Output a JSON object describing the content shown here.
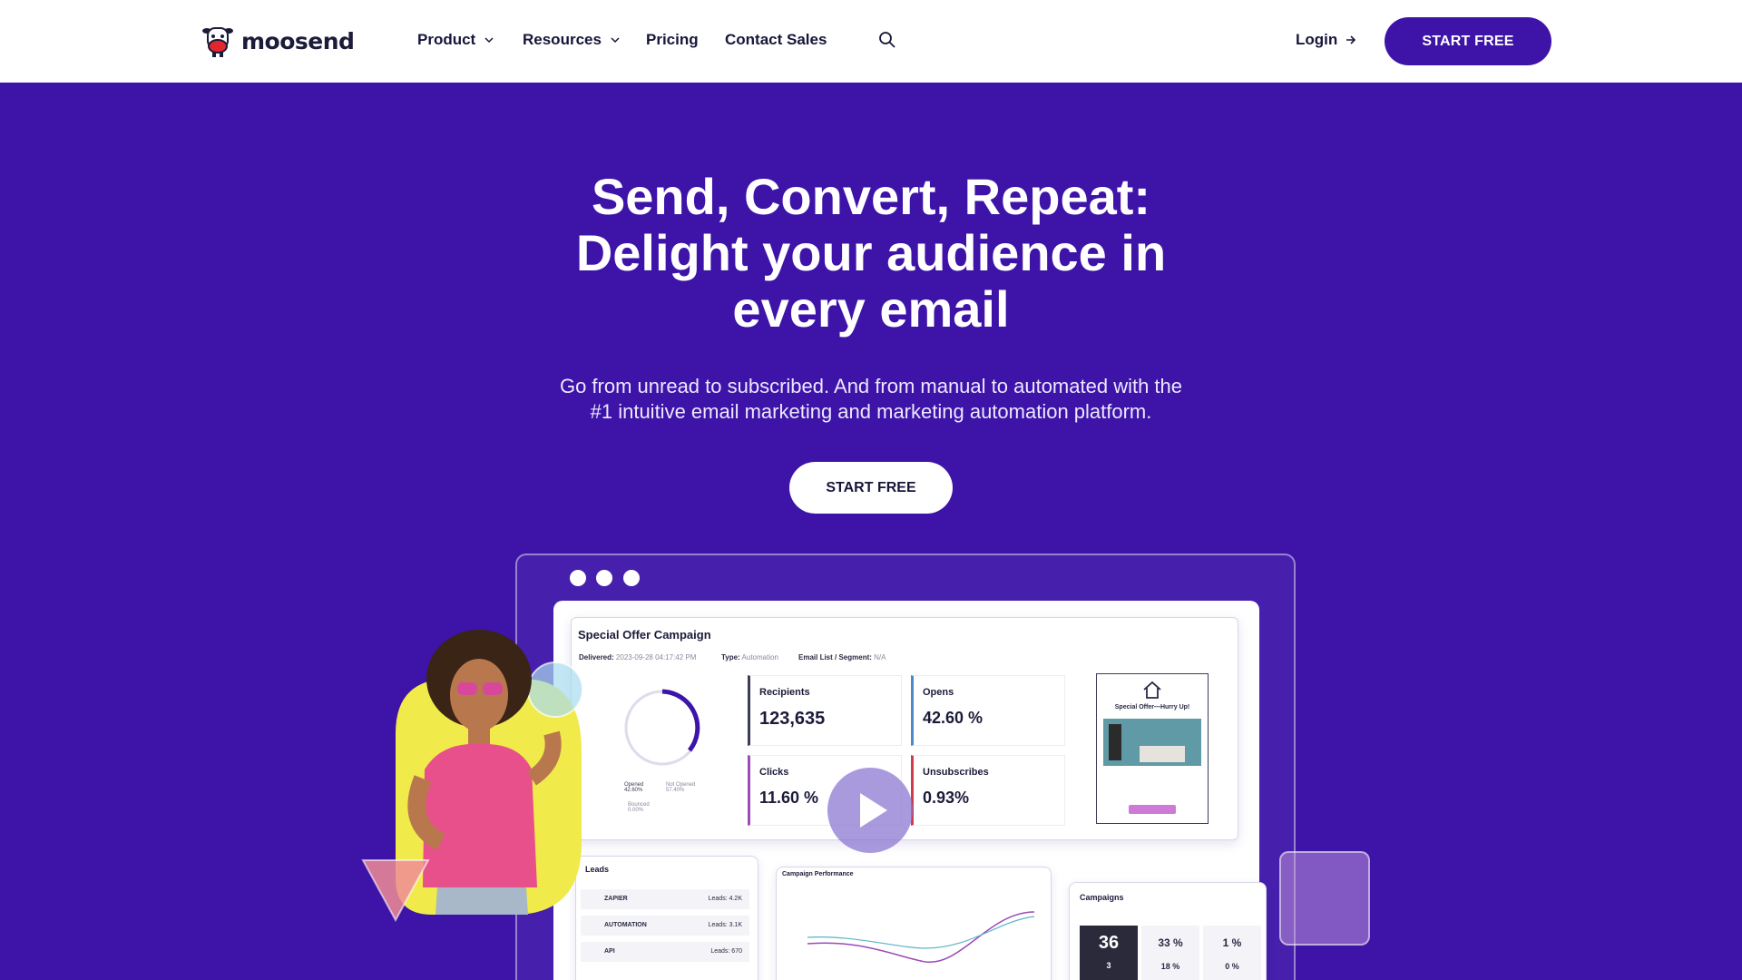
{
  "nav": {
    "logo_text": "moosend",
    "items": [
      {
        "label": "Product",
        "dropdown": true
      },
      {
        "label": "Resources",
        "dropdown": true
      },
      {
        "label": "Pricing",
        "dropdown": false
      },
      {
        "label": "Contact Sales",
        "dropdown": false
      }
    ],
    "login_label": "Login",
    "start_label": "START FREE"
  },
  "hero": {
    "title_line1": "Send, Convert, Repeat:",
    "title_line2": "Delight your audience in",
    "title_line3": "every email",
    "subtitle_line1": "Go from unread to subscribed. And from manual to automated with the",
    "subtitle_line2": "#1 intuitive email marketing and marketing automation platform.",
    "cta_label": "START FREE"
  },
  "dashboard": {
    "campaign_title": "Special Offer Campaign",
    "delivered_label": "Delivered:",
    "delivered_value": "2023-09-28 04:17:42 PM",
    "type_label": "Type:",
    "type_value": "Automation",
    "list_label": "Email List / Segment:",
    "list_value": "N/A",
    "donut_legend": {
      "opened_label": "Opened",
      "opened_value": "42.60%",
      "not_opened_label": "Not Opened",
      "not_opened_value": "57.40%",
      "bounced_label": "Bounced",
      "bounced_value": "0.00%"
    },
    "stats": [
      {
        "label": "Recipients",
        "value": "123,635"
      },
      {
        "label": "Opens",
        "value": "42.60 %"
      },
      {
        "label": "Clicks",
        "value": "11.60 %"
      },
      {
        "label": "Unsubscribes",
        "value": "0.93%"
      }
    ],
    "preview_title": "Special Offer—Hurry Up!",
    "leads": {
      "title": "Leads",
      "rows": [
        {
          "name": "ZAPIER",
          "value": "Leads: 4.2K"
        },
        {
          "name": "AUTOMATION",
          "value": "Leads: 3.1K"
        },
        {
          "name": "API",
          "value": "Leads: 670"
        }
      ]
    },
    "performance_title": "Campaign Performance",
    "campaigns": {
      "title": "Campaigns",
      "boxes": [
        {
          "top": "36",
          "bottom": "3"
        },
        {
          "top": "33 %",
          "bottom": "18 %"
        },
        {
          "top": "1 %",
          "bottom": "0 %"
        }
      ]
    }
  },
  "colors": {
    "brand_purple": "#3d13a8",
    "text_dark": "#16163a"
  }
}
